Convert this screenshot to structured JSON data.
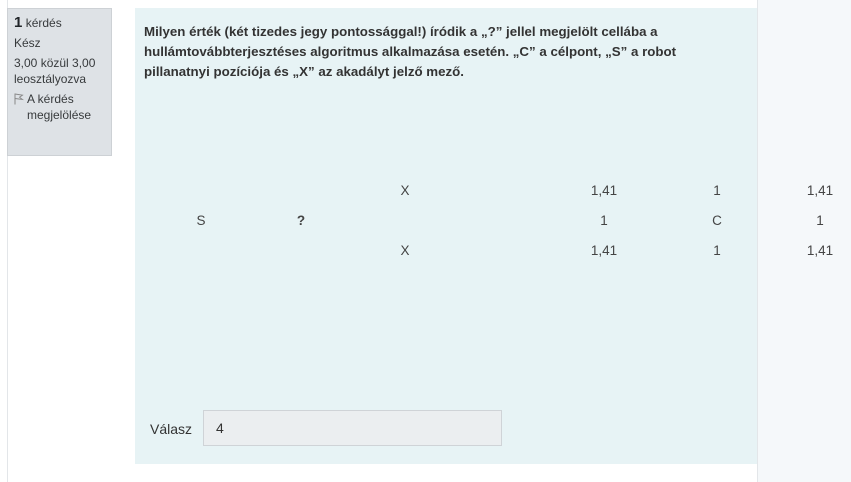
{
  "info": {
    "number": "1",
    "number_label": "kérdés",
    "status": "Kész",
    "grade": "3,00 közül 3,00 leosztályozva",
    "flag_label": "A kérdés megjelölése",
    "flag_icon": "flag-icon"
  },
  "question": {
    "text": "Milyen érték (két tizedes jegy pontossággal!) íródik a „?” jellel megjelölt cellába a hullámtovábbterjesztéses algoritmus alkalmazása esetén. „C” a célpont, „S” a robot pillanatnyi pozíciója és „X” az akadályt jelző mező."
  },
  "grid": {
    "rows": [
      [
        "",
        "",
        "X",
        "1,41",
        "1",
        "1,41"
      ],
      [
        "S",
        "?",
        "",
        "1",
        "C",
        "1"
      ],
      [
        "",
        "",
        "X",
        "1,41",
        "1",
        "1,41"
      ]
    ]
  },
  "answer": {
    "label": "Válasz",
    "value": "4"
  }
}
